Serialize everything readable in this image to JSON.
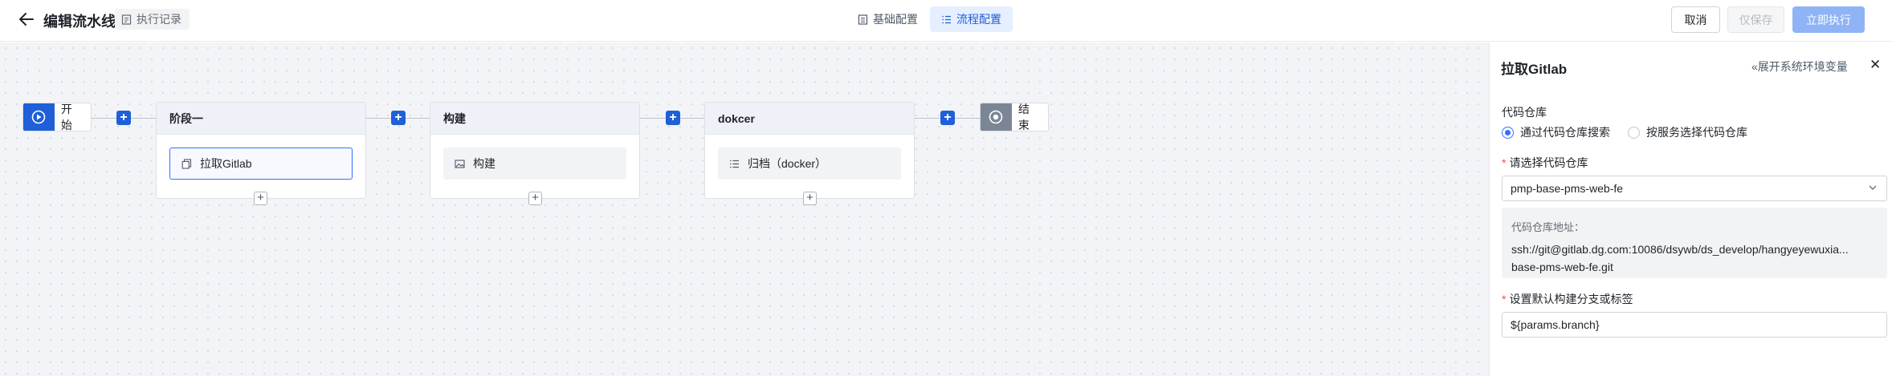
{
  "header": {
    "title": "编辑流水线",
    "exec_log_label": "执行记录",
    "tabs": [
      {
        "label": "基础配置",
        "active": false
      },
      {
        "label": "流程配置",
        "active": true
      }
    ],
    "buttons": {
      "cancel": "取消",
      "save": "仅保存",
      "run": "立即执行"
    }
  },
  "pipeline": {
    "start_label": "开始",
    "end_label": "结束",
    "stages": [
      {
        "name": "阶段一",
        "job": "拉取Gitlab",
        "job_icon": "copy-icon",
        "selected": true
      },
      {
        "name": "构建",
        "job": "构建",
        "job_icon": "image-icon",
        "selected": false
      },
      {
        "name": "dokcer",
        "job": "归档（docker）",
        "job_icon": "list-icon",
        "selected": false
      }
    ]
  },
  "panel": {
    "title": "拉取Gitlab",
    "expand_env_label": "展开系统环境变量",
    "repo_section_label": "代码仓库",
    "radio_options": [
      {
        "label": "通过代码仓库搜索",
        "checked": true
      },
      {
        "label": "按服务选择代码仓库",
        "checked": false
      }
    ],
    "select_repo_label": "请选择代码仓库",
    "select_repo_value": "pmp-base-pms-web-fe",
    "repo_url_label": "代码仓库地址：",
    "repo_url_line1": "ssh://git@gitlab.dg.com:10086/dsywb/ds_develop/hangyeyewuxia...",
    "repo_url_line2": "base-pms-web-fe.git",
    "branch_label": "设置默认构建分支或标签",
    "branch_value": "${params.branch}"
  },
  "colors": {
    "primary": "#1f5fd8",
    "accent_blue": "#3370ff",
    "run_disabled": "#8fb4f5",
    "required": "#f54a45"
  }
}
